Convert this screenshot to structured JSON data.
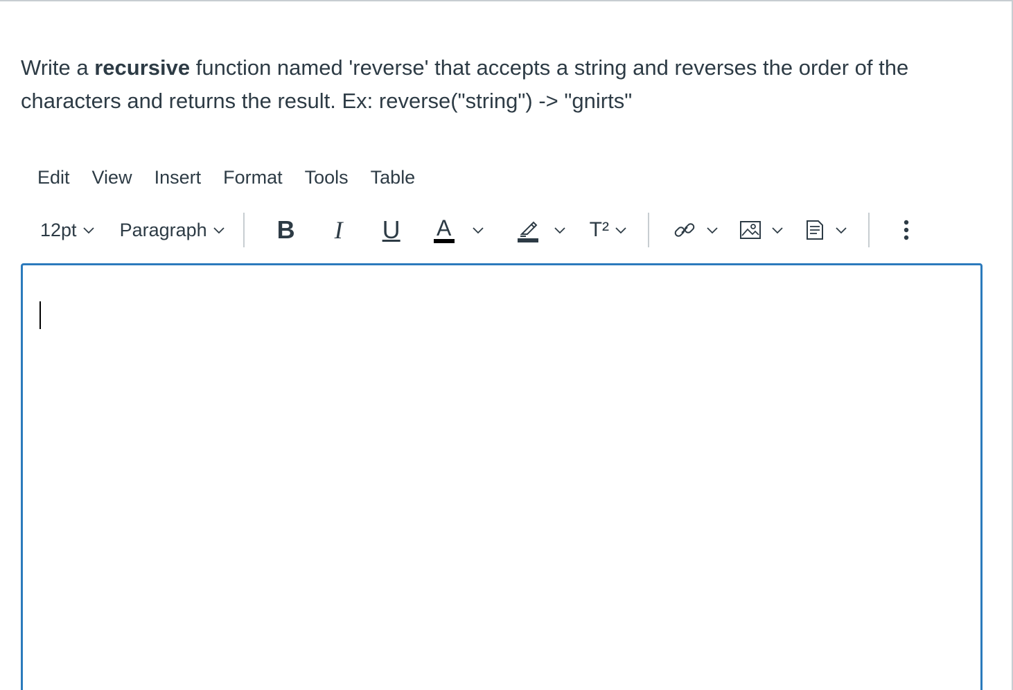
{
  "question": {
    "part1": "Write a ",
    "bold": "recursive",
    "part2": " function named 'reverse' that accepts a string and reverses the order of the characters and returns the result.  Ex: reverse(\"string\") -> \"gnirts\""
  },
  "menubar": {
    "items": [
      "Edit",
      "View",
      "Insert",
      "Format",
      "Tools",
      "Table"
    ]
  },
  "toolbar": {
    "font_size": "12pt",
    "block_format": "Paragraph",
    "bold_label": "B",
    "italic_label": "I",
    "underline_label": "U",
    "text_color_label": "A",
    "superscript_label": "T²",
    "icons": {
      "chevron": "chevron-down-icon",
      "highlight": "highlighter-icon",
      "link": "link-icon",
      "image": "image-icon",
      "document": "document-icon",
      "more": "more-vertical-icon"
    }
  },
  "editor": {
    "content": ""
  },
  "colors": {
    "text": "#2d3b45",
    "editor_border": "#2b7abc",
    "separator": "#c7cdd1"
  }
}
